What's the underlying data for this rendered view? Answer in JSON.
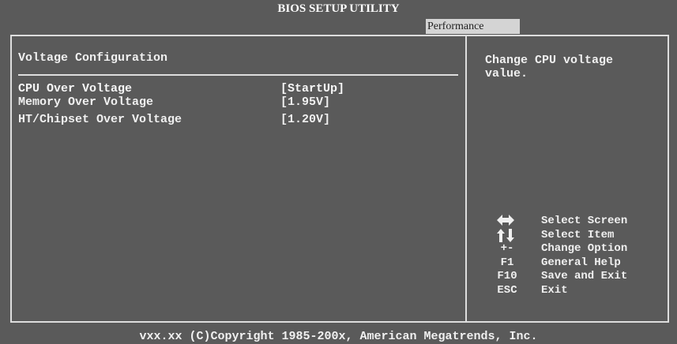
{
  "header": {
    "title": "BIOS SETUP UTILITY",
    "active_tab": "Performance"
  },
  "main": {
    "section_title": "Voltage Configuration",
    "items": [
      {
        "label": "CPU Over Voltage",
        "value": "[StartUp]",
        "selected": true
      },
      {
        "label": "Memory Over Voltage",
        "value": "[1.95V]",
        "selected": false
      },
      {
        "label": "HT/Chipset Over Voltage",
        "value": "[1.20V]",
        "selected": false
      }
    ]
  },
  "help_panel": {
    "text": "Change CPU voltage\nvalue.",
    "keys": [
      {
        "key": "",
        "icon": "left-right-arrow-icon",
        "desc": "Select Screen"
      },
      {
        "key": "",
        "icon": "up-down-arrow-icon",
        "desc": "Select Item"
      },
      {
        "key": "+-",
        "desc": "Change Option"
      },
      {
        "key": "F1",
        "desc": "General Help"
      },
      {
        "key": "F10",
        "desc": "Save and Exit"
      },
      {
        "key": "ESC",
        "desc": "Exit"
      }
    ]
  },
  "footer": {
    "copyright": "vxx.xx (C)Copyright 1985-200x, American Megatrends, Inc."
  },
  "colors": {
    "background": "#5a5a5a",
    "text": "#f0f0f0",
    "tab_bg": "#d4d4d4"
  }
}
